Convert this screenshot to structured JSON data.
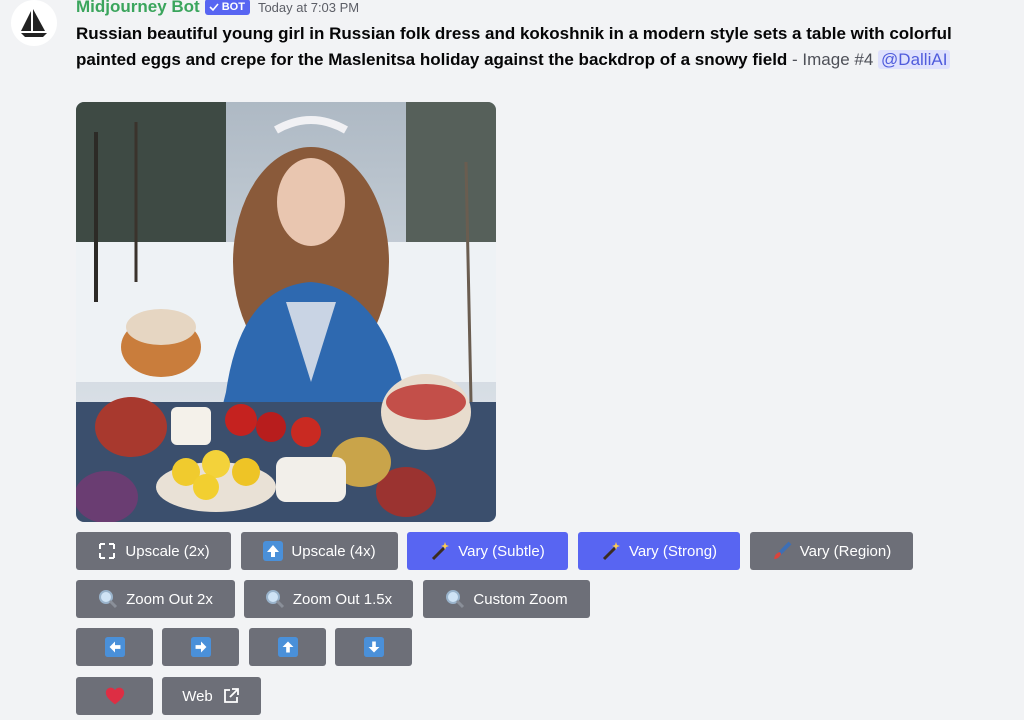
{
  "author": {
    "name": "Midjourney Bot",
    "tag": "BOT",
    "timestamp": "Today at 7:03 PM"
  },
  "message": {
    "prompt": "Russian beautiful young girl in Russian folk dress and kokoshnik in a modern style sets a table with colorful painted eggs and crepe for the Maslenitsa holiday against the backdrop of a snowy field",
    "suffix": " - Image #4 ",
    "mention": "@DalliAI"
  },
  "buttons": {
    "upscale_2x": "Upscale (2x)",
    "upscale_4x": "Upscale (4x)",
    "vary_subtle": "Vary (Subtle)",
    "vary_strong": "Vary (Strong)",
    "vary_region": "Vary (Region)",
    "zoom_out_2x": "Zoom Out 2x",
    "zoom_out_1_5x": "Zoom Out 1.5x",
    "custom_zoom": "Custom Zoom",
    "web": "Web"
  },
  "colors": {
    "accent": "#5865f2",
    "button": "#6d6f78",
    "username": "#3ba55d",
    "arrow_icon": "#4a90d9",
    "heart": "#dd2e44"
  },
  "icons": [
    "midjourney-logo",
    "checkmark-icon",
    "expand-icon",
    "up-arrow-icon",
    "magic-wand-icon",
    "paintbrush-icon",
    "magnifier-icon",
    "arrow-left-icon",
    "arrow-right-icon",
    "arrow-up-icon",
    "arrow-down-icon",
    "heart-icon",
    "external-link-icon"
  ]
}
